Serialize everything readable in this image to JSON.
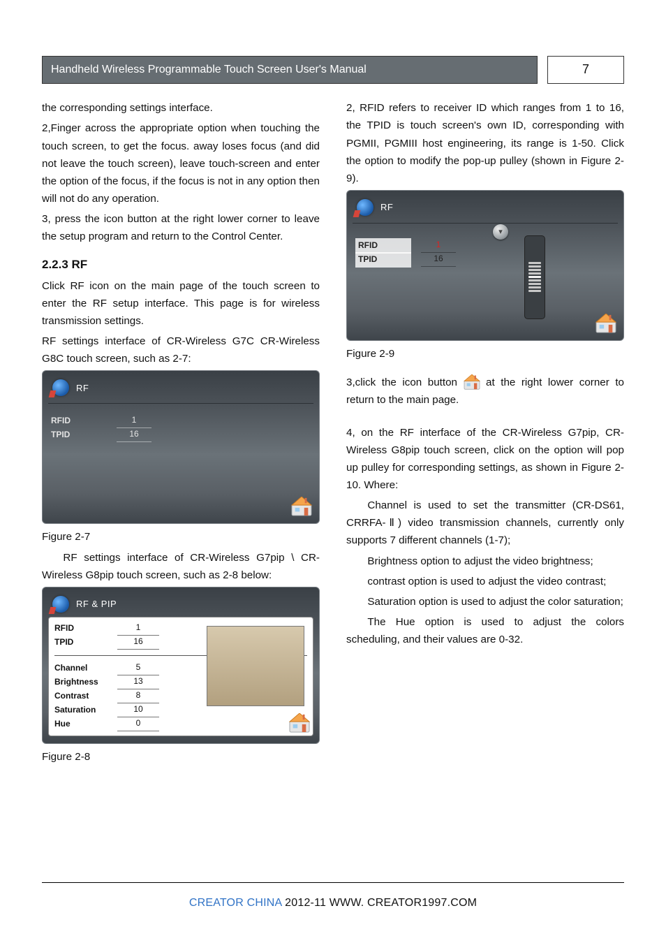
{
  "header": {
    "title": "Handheld Wireless Programmable Touch Screen User's Manual",
    "page": "7"
  },
  "left": {
    "p1": "the corresponding settings interface.",
    "p2": "2,Finger across the appropriate option when touching the touch screen, to get the focus. away loses focus (and did not leave the touch screen), leave touch-screen and enter the option of the focus, if the focus is not in any option then will not do any operation.",
    "p3": "3, press the icon button at the right lower corner to leave the setup program and return to the Control Center.",
    "h223": "2.2.3   RF",
    "p4": "Click RF icon on the main page of the touch screen to enter the RF setup interface. This page is for wireless transmission settings.",
    "p5": "RF settings interface of CR-Wireless G7C CR-Wireless G8C touch screen, such as 2-7:",
    "fig27": {
      "title": "RF",
      "rfid_lbl": "RFID",
      "rfid_val": "1",
      "tpid_lbl": "TPID",
      "tpid_val": "16"
    },
    "fig27_caption": "Figure 2-7",
    "p6": "RF settings interface of CR-Wireless G7pip \\ CR-Wireless G8pip touch screen, such as 2-8 below:",
    "fig28": {
      "title": "RF & PIP",
      "rows": [
        {
          "lbl": "RFID",
          "val": "1"
        },
        {
          "lbl": "TPID",
          "val": "16"
        },
        {
          "lbl": "Channel",
          "val": "5"
        },
        {
          "lbl": "Brightness",
          "val": "13"
        },
        {
          "lbl": "Contrast",
          "val": "8"
        },
        {
          "lbl": "Saturation",
          "val": "10"
        },
        {
          "lbl": "Hue",
          "val": "0"
        }
      ]
    },
    "fig28_caption": "Figure 2-8"
  },
  "right": {
    "p1": "2, RFID refers to receiver ID which ranges from 1 to 16, the TPID is touch screen's own ID, corresponding with PGMII, PGMIII host engineering, its range is 1-50. Click the option to modify the pop-up pulley (shown in Figure 2-9).",
    "fig29": {
      "title": "RF",
      "rfid_lbl": "RFID",
      "rfid_val": "1",
      "tpid_lbl": "TPID",
      "tpid_val": "16"
    },
    "fig29_caption": "Figure 2-9",
    "p2a": "3,click the icon button ",
    "p2b": " at the right lower corner to return to the main page.",
    "p3": "4, on the RF interface of the CR-Wireless G7pip, CR-Wireless G8pip touch screen, click on the option will pop up pulley for corresponding settings, as shown in Figure 2-10. Where:",
    "p4": "Channel is used to set the transmitter (CR-DS61, CRRFA-Ⅱ) video transmission channels, currently only supports 7 different channels (1-7);",
    "p5": "Brightness option to adjust the video brightness;",
    "p6": "contrast option is used to adjust the video contrast;",
    "p7": "Saturation option is used to adjust the color saturation;",
    "p8": "The Hue option is used to adjust the colors scheduling, and their values     are 0-32."
  },
  "footer": {
    "brand": "CREATOR CHINA",
    "rest": "   2012-11   WWW. CREATOR1997.COM"
  }
}
